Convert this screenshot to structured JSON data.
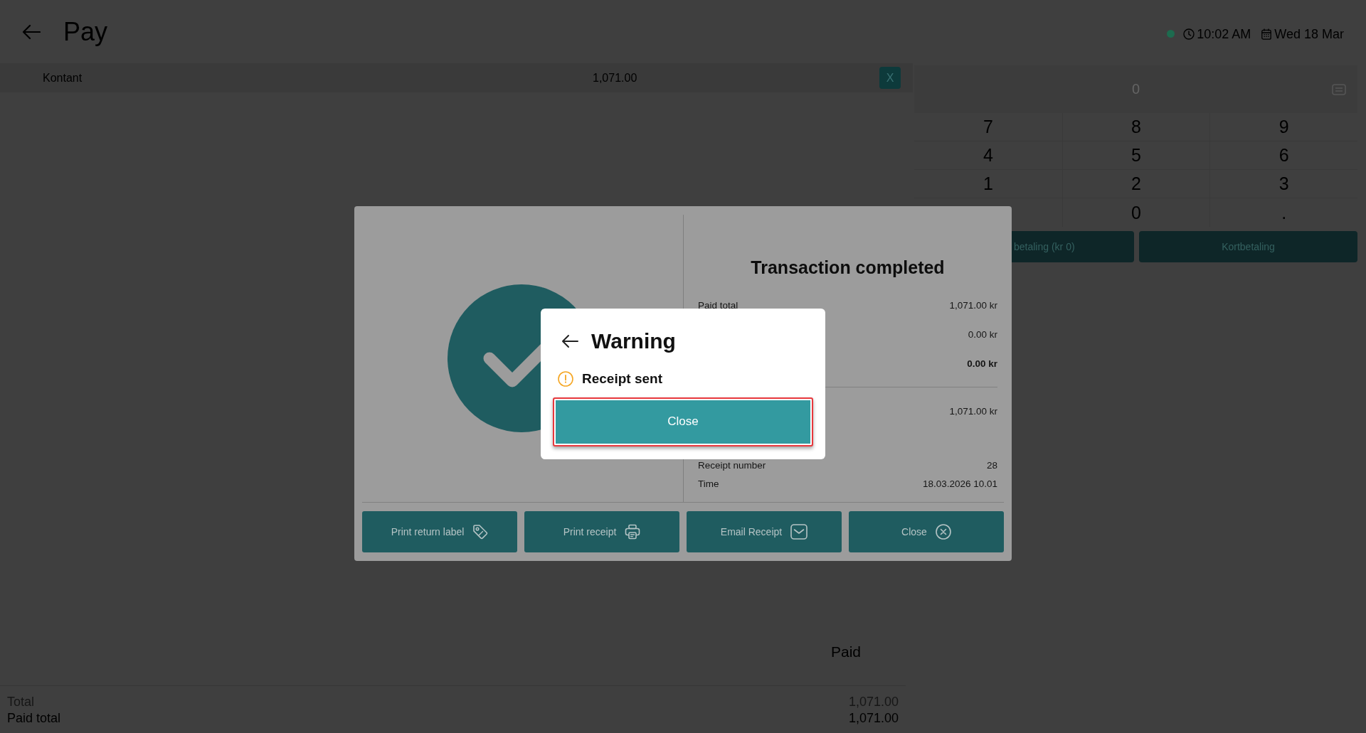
{
  "header": {
    "title": "Pay",
    "connected": true,
    "time": "10:02 AM",
    "date": "Wed 18 Mar"
  },
  "payment_lines": [
    {
      "method": "Kontant",
      "amount": "1,071.00",
      "remove": "X"
    }
  ],
  "keypad": {
    "placeholder": "0",
    "rows": [
      [
        "7",
        "8",
        "9"
      ],
      [
        "4",
        "5",
        "6"
      ],
      [
        "1",
        "2",
        "3"
      ],
      [
        "",
        "0",
        "."
      ]
    ]
  },
  "payment_buttons": [
    {
      "label": "betaling (kr 0)"
    },
    {
      "label": "Kortbetaling"
    }
  ],
  "summary": {
    "heading": "Paid",
    "rows": [
      {
        "label": "Total",
        "value": "1,071.00",
        "muted": true
      },
      {
        "label": "Paid total",
        "value": "1,071.00",
        "muted": false
      }
    ]
  },
  "transaction_dialog": {
    "title": "Transaction completed",
    "sections": [
      {
        "divider": false,
        "rows": [
          {
            "label": "Paid total",
            "value": "1,071.00 kr",
            "bold": false
          },
          {
            "value": "0.00 kr",
            "bold": false
          },
          {
            "value": "0.00 kr",
            "bold": true
          }
        ]
      },
      {
        "divider": true,
        "rows": [
          {
            "value": "1,071.00 kr",
            "bold": false
          }
        ]
      },
      {
        "divider": false,
        "rows": [
          {
            "label": "Receipt number",
            "value": "28",
            "bold": false
          },
          {
            "label": "Time",
            "value": "18.03.2026 10.01",
            "bold": false
          }
        ]
      }
    ],
    "actions": [
      {
        "kind": "return-label",
        "label": "Print return label"
      },
      {
        "kind": "print",
        "label": "Print receipt"
      },
      {
        "kind": "email",
        "label": "Email Receipt"
      },
      {
        "kind": "close",
        "label": "Close"
      }
    ]
  },
  "warning_dialog": {
    "title": "Warning",
    "message": "Receipt sent",
    "button": {
      "label": "Close",
      "highlighted": true
    }
  }
}
